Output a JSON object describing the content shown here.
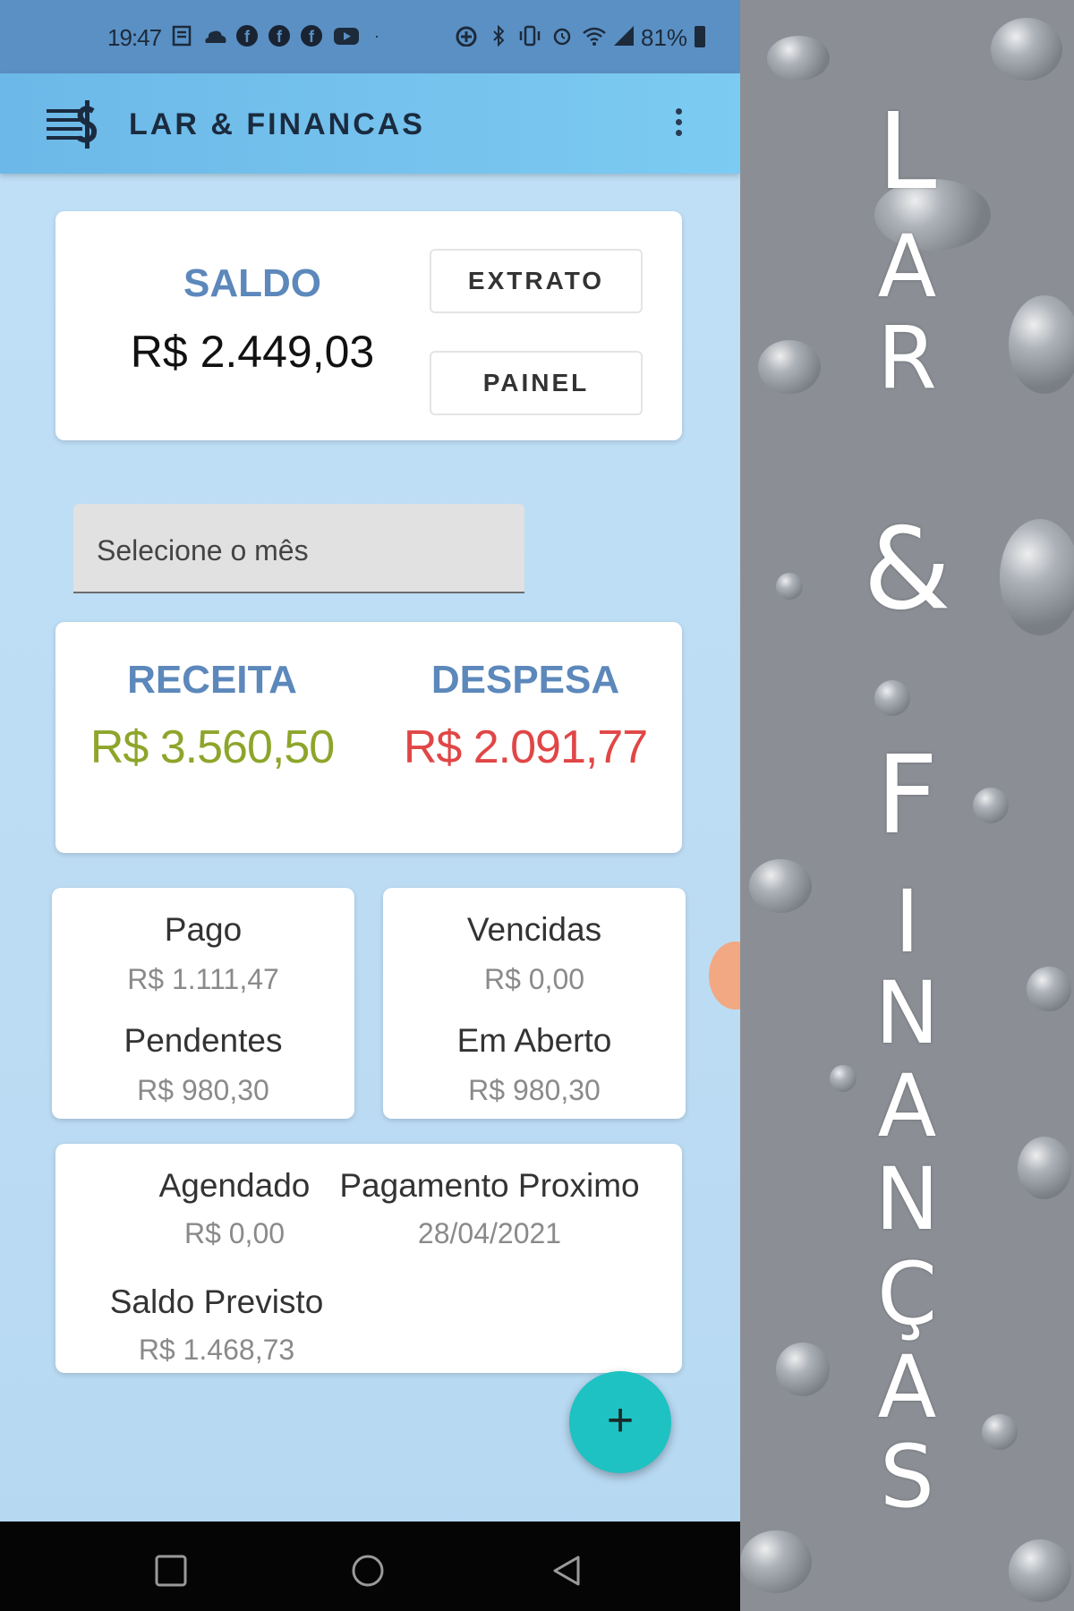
{
  "status_bar": {
    "time": "19:47",
    "battery": "81%"
  },
  "app_bar": {
    "title": "LAR & FINANCAS"
  },
  "saldo": {
    "label": "SALDO",
    "value": "R$ 2.449,03",
    "extrato_label": "EXTRATO",
    "painel_label": "PAINEL"
  },
  "month_select": {
    "placeholder": "Selecione o mês"
  },
  "summary": {
    "receita_label": "RECEITA",
    "receita_value": "R$ 3.560,50",
    "despesa_label": "DESPESA",
    "despesa_value": "R$ 2.091,77"
  },
  "status_cards": {
    "pago_label": "Pago",
    "pago_value": "R$ 1.111,47",
    "pendentes_label": "Pendentes",
    "pendentes_value": "R$ 980,30",
    "vencidas_label": "Vencidas",
    "vencidas_value": "R$ 0,00",
    "em_aberto_label": "Em Aberto",
    "em_aberto_value": "R$ 980,30"
  },
  "previsao": {
    "agendado_label": "Agendado",
    "agendado_value": "R$ 0,00",
    "pagamento_label": "Pagamento Proximo",
    "pagamento_value": "28/04/2021",
    "saldo_previsto_label": "Saldo Previsto",
    "saldo_previsto_value": "R$ 1.468,73"
  },
  "fab_label": "+",
  "side_banner": {
    "letters": [
      "L",
      "A",
      "R",
      "&",
      "F",
      "I",
      "N",
      "A",
      "N",
      "Ç",
      "A",
      "S"
    ]
  },
  "colors": {
    "accent_blue": "#5c88bb",
    "receita_green": "#8da52a",
    "despesa_red": "#e14646",
    "fab_teal": "#1ec2c2",
    "app_bar": "#7ccbf2"
  },
  "icons": {
    "app_logo": "dollar-menu-icon",
    "overflow": "more-vert-icon",
    "nav_recents": "square-icon",
    "nav_home": "circle-icon",
    "nav_back": "triangle-back-icon"
  }
}
